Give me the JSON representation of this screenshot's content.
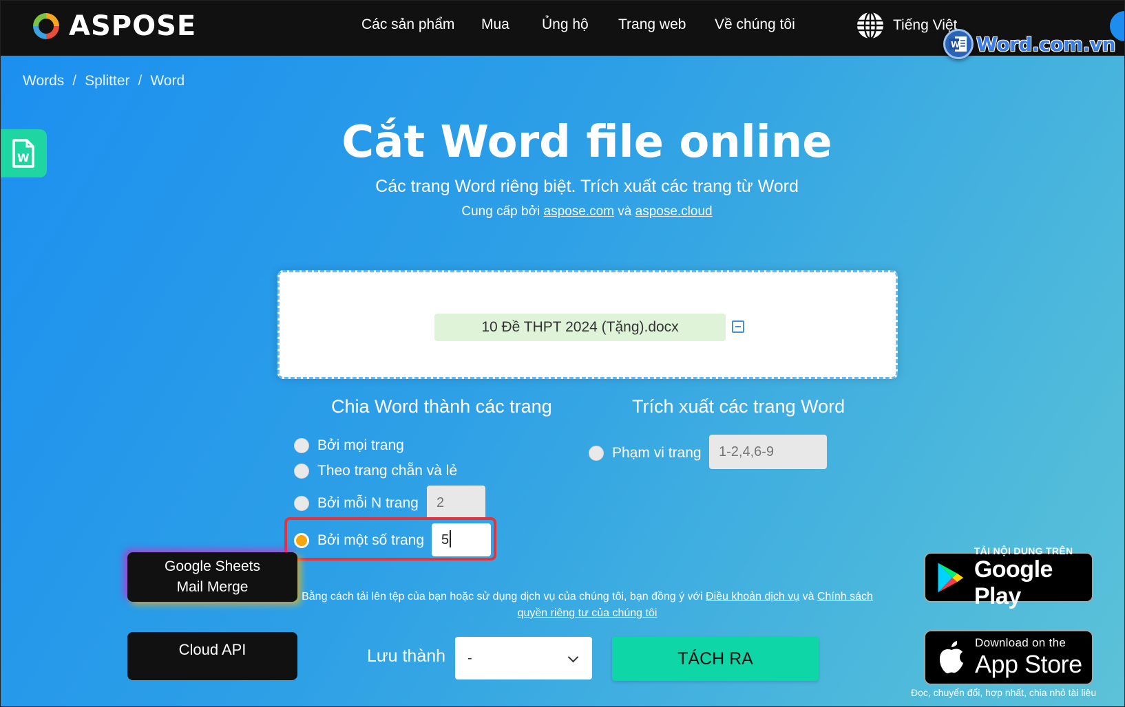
{
  "header": {
    "brand": "ASPOSE",
    "nav": [
      "Các sản phẩm",
      "Mua",
      "Ủng hộ",
      "Trang web",
      "Về chúng tôi"
    ],
    "language": "Tiếng Việt",
    "watermark": "Word.com.vn"
  },
  "breadcrumb": [
    "Words",
    "Splitter",
    "Word"
  ],
  "hero": {
    "title": "Cắt Word file online",
    "subtitle": "Các trang Word riêng biệt. Trích xuất các trang từ Word",
    "powered_prefix": "Cung cấp bởi",
    "powered_link1": "aspose.com",
    "powered_and": "và",
    "powered_link2": "aspose.cloud"
  },
  "upload": {
    "file_name": "10 Đề THPT 2024 (Tặng).docx"
  },
  "split": {
    "title": "Chia Word thành các trang",
    "options": [
      {
        "label": "Bởi mọi trang",
        "checked": false
      },
      {
        "label": "Theo trang chẵn và lẻ",
        "checked": false
      },
      {
        "label": "Bởi mỗi N trang",
        "checked": false
      },
      {
        "label": "Bởi một số trang",
        "checked": true
      }
    ],
    "n_pages_placeholder": "2",
    "some_pages_value": "5"
  },
  "extract": {
    "title": "Trích xuất các trang Word",
    "option": "Phạm vi trang",
    "range_placeholder": "1-2,4,6-9"
  },
  "side_buttons": {
    "google_sheets_line1": "Google Sheets",
    "google_sheets_line2": "Mail Merge",
    "cloud_api": "Cloud API"
  },
  "terms": {
    "text": "Bằng cách tải lên tệp của bạn hoặc sử dụng dịch vụ của chúng tôi, bạn đồng ý với",
    "link1": "Điều khoản dịch vụ",
    "and": "và",
    "link2": "Chính sách quyền riêng tư của chúng tôi"
  },
  "save": {
    "label": "Lưu thành",
    "selected": "-",
    "button": "TÁCH RA"
  },
  "stores": {
    "google_small": "TẢI NỘI DUNG TRÊN",
    "google_big": "Google Play",
    "apple_small": "Download on the",
    "apple_big": "App Store",
    "footer": "Đọc, chuyển đổi, hợp nhất, chia nhỏ tài liệu"
  },
  "colors": {
    "accent_green": "#0fd6a6",
    "selected_radio": "#f7a60e",
    "highlight_red": "#e2343b",
    "header_bg": "#111111"
  }
}
